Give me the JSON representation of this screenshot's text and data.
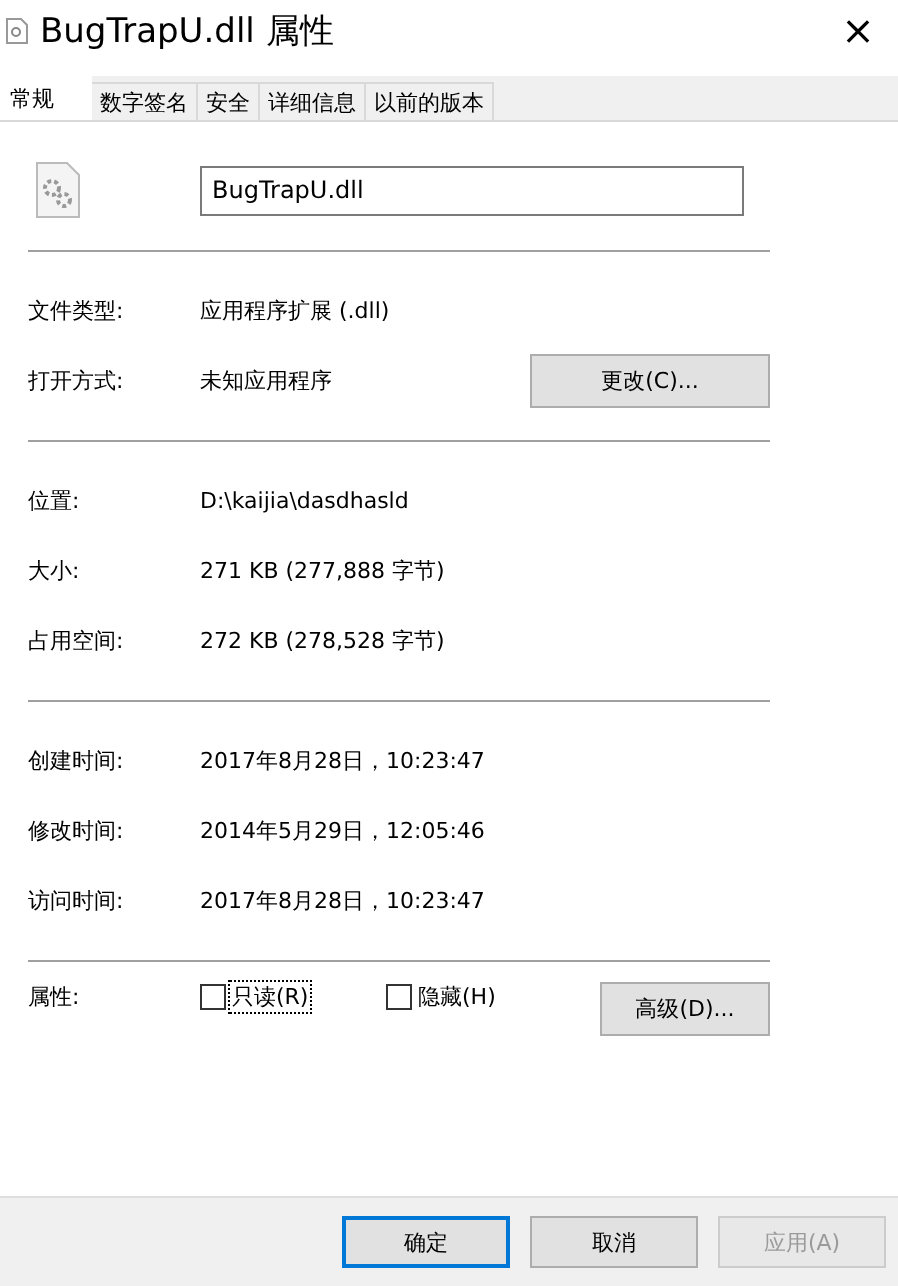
{
  "window": {
    "title": "BugTrapU.dll 属性",
    "close": "×"
  },
  "tabs": [
    {
      "label": "常规",
      "selected": true
    },
    {
      "label": "数字签名",
      "selected": false
    },
    {
      "label": "安全",
      "selected": false
    },
    {
      "label": "详细信息",
      "selected": false
    },
    {
      "label": "以前的版本",
      "selected": false
    }
  ],
  "file_name": "BugTrapU.dll",
  "groups": [
    [
      {
        "label": "文件类型:",
        "value": "应用程序扩展 (.dll)"
      },
      {
        "label": "打开方式:",
        "value": "未知应用程序",
        "button": "更改(C)..."
      }
    ],
    [
      {
        "label": "位置:",
        "value": "D:\\kaijia\\dasdhasld"
      },
      {
        "label": "大小:",
        "value": "271 KB (277,888 字节)"
      },
      {
        "label": "占用空间:",
        "value": "272 KB (278,528 字节)"
      }
    ],
    [
      {
        "label": "创建时间:",
        "value": "2017年8月28日，10:23:47"
      },
      {
        "label": "修改时间:",
        "value": "2014年5月29日，12:05:46"
      },
      {
        "label": "访问时间:",
        "value": "2017年8月28日，10:23:47"
      }
    ]
  ],
  "attributes": {
    "label": "属性:",
    "checkboxes": [
      {
        "label": "只读(R)",
        "checked": false
      },
      {
        "label": "隐藏(H)",
        "checked": false
      }
    ],
    "button": "高级(D)..."
  },
  "buttons": [
    {
      "label": "确定",
      "default": true,
      "disabled": false
    },
    {
      "label": "取消",
      "default": false,
      "disabled": false
    },
    {
      "label": "应用(A)",
      "default": false,
      "disabled": true
    }
  ]
}
